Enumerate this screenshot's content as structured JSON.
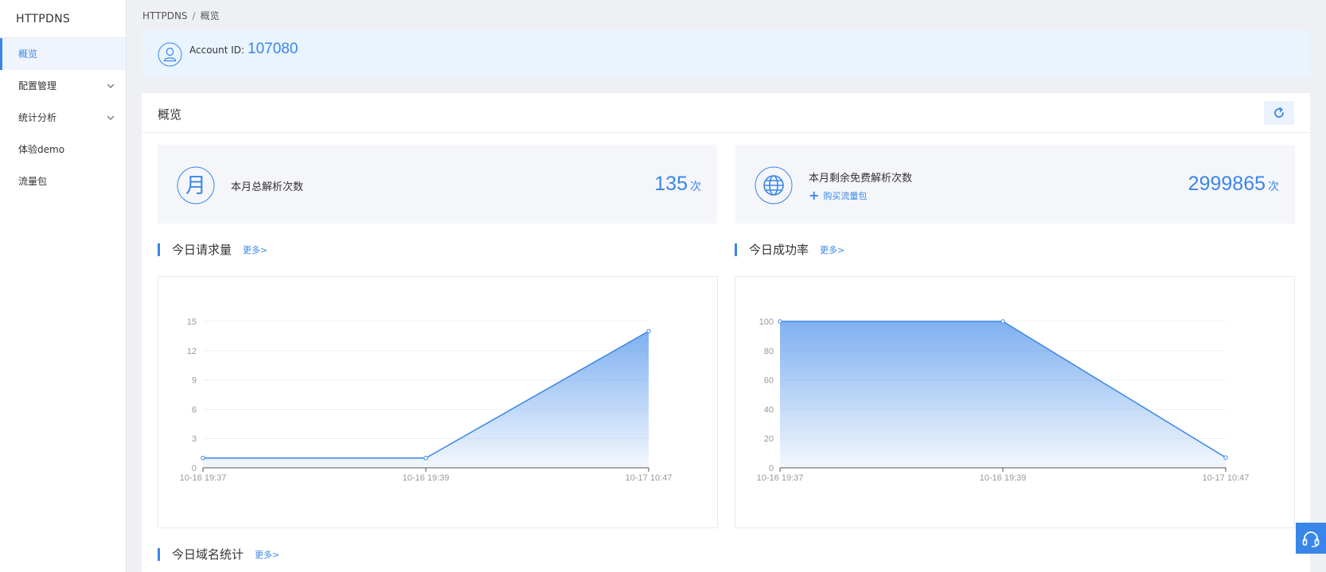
{
  "sidebar": {
    "brand": "HTTPDNS",
    "items": [
      {
        "label": "概览",
        "active": true,
        "has_children": false
      },
      {
        "label": "配置管理",
        "active": false,
        "has_children": true
      },
      {
        "label": "统计分析",
        "active": false,
        "has_children": true
      },
      {
        "label": "体验demo",
        "active": false,
        "has_children": false
      },
      {
        "label": "流量包",
        "active": false,
        "has_children": false
      }
    ]
  },
  "breadcrumb": {
    "root": "HTTPDNS",
    "separator": "/",
    "current": "概览"
  },
  "account": {
    "label": "Account ID:",
    "id": "107080",
    "icon": "user-icon"
  },
  "overview": {
    "title": "概览",
    "refresh_icon": "refresh-icon",
    "cards": [
      {
        "icon": "month-calendar-icon",
        "icon_glyph": "月",
        "label": "本月总解析次数",
        "value": "135",
        "unit": "次"
      },
      {
        "icon": "globe-icon",
        "label": "本月剩余免费解析次数",
        "value": "2999865",
        "unit": "次",
        "link_label": "购买流量包"
      }
    ]
  },
  "sections": {
    "requests": {
      "title": "今日请求量",
      "more": "更多>"
    },
    "success": {
      "title": "今日成功率",
      "more": "更多>"
    },
    "domains": {
      "title": "今日域名统计",
      "more": "更多>"
    }
  },
  "chart_data": [
    {
      "type": "area",
      "title": "",
      "x": [
        "10-16 19:37",
        "10-16 19:39",
        "10-17 10:47"
      ],
      "series": [
        {
          "values": [
            1,
            1,
            14
          ]
        }
      ],
      "yticks": [
        0,
        3,
        6,
        9,
        12,
        15
      ],
      "ylim": [
        0,
        15
      ],
      "grid": true,
      "color": "#3a86e8"
    },
    {
      "type": "area",
      "title": "",
      "x": [
        "10-16 19:37",
        "10-16 19:39",
        "10-17 10:47"
      ],
      "series": [
        {
          "values": [
            100,
            100,
            7
          ]
        }
      ],
      "yticks": [
        0,
        20,
        40,
        60,
        80,
        100
      ],
      "ylim": [
        0,
        100
      ],
      "grid": true,
      "color": "#3a86e8"
    }
  ],
  "support": {
    "icon": "headset-icon"
  }
}
